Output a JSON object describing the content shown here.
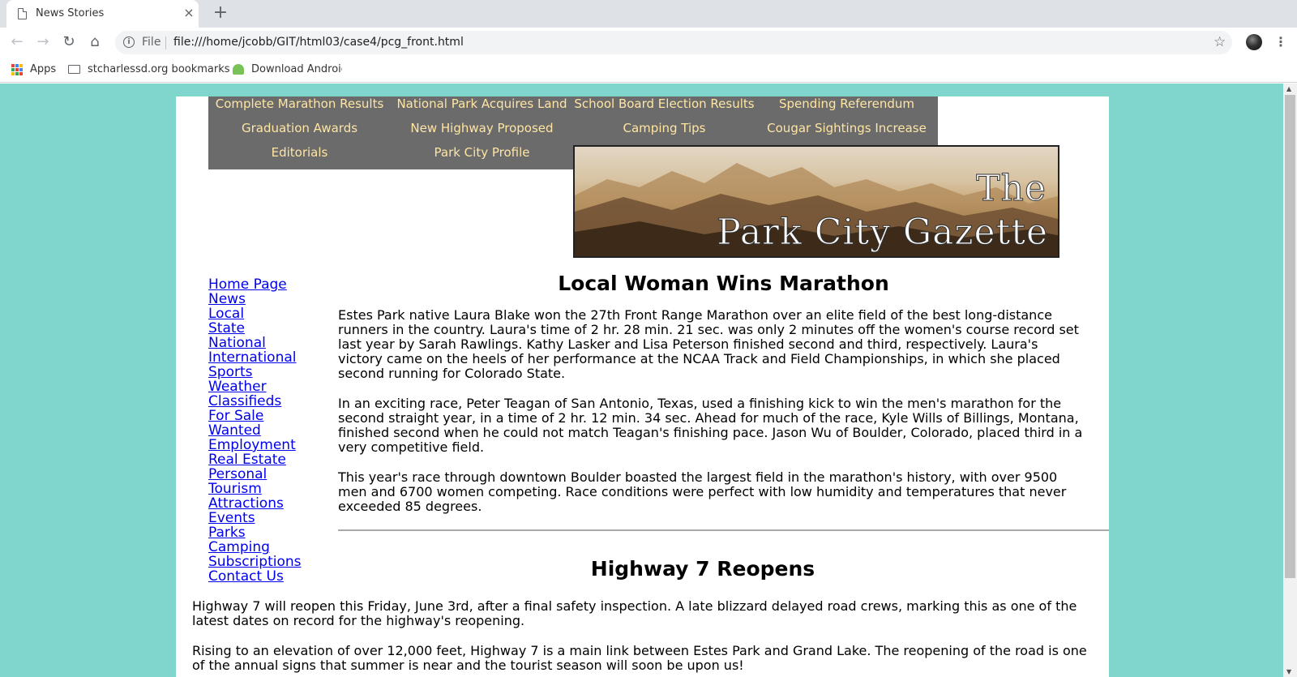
{
  "browser": {
    "tab_title": "News Stories",
    "tab_close": "×",
    "new_tab": "+",
    "scheme_label": "File",
    "url": "file:///home/jcobb/GIT/html03/case4/pcg_front.html",
    "bookmarks": [
      "Apps",
      "stcharlessd.org bookmarks",
      "Download Android"
    ]
  },
  "topnav": [
    "Complete Marathon Results",
    "National Park Acquires Land",
    "School Board Election Results",
    "Spending Referendum",
    "Graduation Awards",
    "New Highway Proposed",
    "Camping Tips",
    "Cougar Sightings Increase",
    "Editorials",
    "Park City Profile"
  ],
  "banner": {
    "line1": "The",
    "line2": "Park City Gazette"
  },
  "sidenav": [
    "Home Page",
    "News",
    "Local",
    "State",
    "National",
    "International",
    "Sports",
    "Weather",
    "Classifieds",
    "For Sale",
    "Wanted",
    "Employment",
    "Real Estate",
    "Personal",
    "Tourism",
    "Attractions",
    "Events",
    "Parks",
    "Camping",
    "Subscriptions",
    "Contact Us"
  ],
  "article1": {
    "title": "Local Woman Wins Marathon",
    "paragraphs": [
      "Estes Park native Laura Blake won the 27th Front Range Marathon over an elite field of the best long-distance runners in the country. Laura's time of 2 hr. 28 min. 21 sec. was only 2 minutes off the women's course record set last year by Sarah Rawlings. Kathy Lasker and Lisa Peterson finished second and third, respectively. Laura's victory came on the heels of her performance at the NCAA Track and Field Championships, in which she placed second running for Colorado State.",
      "In an exciting race, Peter Teagan of San Antonio, Texas, used a finishing kick to win the men's marathon for the second straight year, in a time of 2 hr. 12 min. 34 sec. Ahead for much of the race, Kyle Wills of Billings, Montana, finished second when he could not match Teagan's finishing pace. Jason Wu of Boulder, Colorado, placed third in a very competitive field.",
      "This year's race through downtown Boulder boasted the largest field in the marathon's history, with over 9500 men and 6700 women competing. Race conditions were perfect with low humidity and temperatures that never exceeded 85 degrees."
    ]
  },
  "article2": {
    "title": "Highway 7 Reopens",
    "paragraphs": [
      "Highway 7 will reopen this Friday, June 3rd, after a final safety inspection. A late blizzard delayed road crews, marking this as one of the latest dates on record for the highway's reopening.",
      "Rising to an elevation of over 12,000 feet, Highway 7 is a main link between Estes Park and Grand Lake. The reopening of the road is one of the annual signs that summer is near and the tourist season will soon be upon us!"
    ]
  },
  "colors": {
    "page_bg": "#80d6cc",
    "nav_bg": "#6b6b6b",
    "nav_text": "#ffe5a3",
    "link": "#0000ee"
  }
}
